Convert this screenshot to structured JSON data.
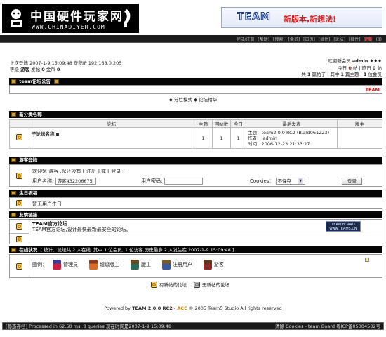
{
  "header": {
    "logo_cn": "中国硬件玩家网",
    "logo_en": "WWW.CHINADIYER.COM",
    "banner_team": "TEAM",
    "banner_slogan": "新版本,新想法!"
  },
  "navbar": {
    "links": [
      "登陆/注册",
      "[帮助]",
      "[搜索]",
      "[会员]",
      "[日历]",
      "[插件]",
      "[论坛]",
      "[插件]"
    ],
    "highlight": "更新",
    "tail": "(8)"
  },
  "user_left": {
    "line1": "上次登陆 2007-1-9 15:09:48 登陆IP 192.168.0.205",
    "line2_prefix": "等级",
    "role": "游客",
    "posts_label": "发帖",
    "posts": "0",
    "gold_label": "金币",
    "gold": "0"
  },
  "user_right": {
    "welcome": "欢迎新会员",
    "new_member": "admin",
    "stars": "♦♦♦",
    "today_label": "今日",
    "today": "0",
    "today_unit": "帖",
    "yesterday_label": "昨日",
    "yesterday": "0",
    "yesterday_unit": "帖",
    "stats": "共",
    "topics": "1",
    "stats2": "篇帖子 | 其中",
    "main": "1",
    "stats3": "篇主题 |",
    "members": "1",
    "stats4": "位会员"
  },
  "announce": {
    "title": "team论坛公告",
    "badge": "TEAM"
  },
  "modes": {
    "mode1": "分栏模式",
    "mode2": "论坛精华"
  },
  "category": {
    "title": "新分类名称",
    "headers": [
      "论坛",
      "主题",
      "回帖数",
      "今日",
      "最后发表",
      "版主"
    ],
    "forum_name": "子论坛名称",
    "topics": "1",
    "replies": "1",
    "today": "1",
    "last_topic": "主题：team2.0.0 RC2 (Build061223)",
    "last_author": "作者： admin",
    "last_time": "时间：2006-12-23 21:33:27",
    "moderator": ""
  },
  "guest": {
    "title": "游客登陆",
    "welcome": "欢迎您 游客 ,您还没有 [ 注册 ] 或 [ 登录 ]",
    "user_label": "用户名称:",
    "user_value": "游客432206675",
    "pass_label": "用户密码:",
    "pass_value": "",
    "cookies_label": "Cookies：",
    "cookies_value": "不保存",
    "login_btn": "登录"
  },
  "birthday": {
    "title": "生日祝福",
    "text": "暂无用户生日"
  },
  "links": {
    "title": "友情链接",
    "name": "TEAM官方论坛",
    "desc": "TEAM官方论坛,设计最快最新最安全的论坛。",
    "logo_line1": "TEAM BOARD",
    "logo_line2": "www.TEAM5.CN"
  },
  "online": {
    "title": "在线状况",
    "summary": "[ 统计：论坛共 2 人在线, 其中 1 位会员, 1 位访客,历史最多 2 人发生在 2007-1-9 15:09:48 ]",
    "legend_label": "图例：",
    "roles": [
      "管理员",
      "超级版主",
      "版主",
      "注册用户",
      "游客"
    ]
  },
  "legend": {
    "new_posts": "有新帖的论坛",
    "no_new_posts": "无新帖的论坛"
  },
  "footer": {
    "powered": "Powered by",
    "version": "TEAM 2.0.0 RC2",
    "dash": " - ",
    "acc": "ACC",
    "copyright": "© 2005 Team5 Studio All rights reserved",
    "status_left": "[静态存档] Processed in 62.50 ms, 8 queries 现在时间是2007-1-9 15:09:48",
    "status_right": "清除 Cookies - team Board 粤ICP备05004532号"
  },
  "colors": {
    "dark_bar": "#050505",
    "accent_red": "#d11111",
    "gold_icon": "#c8a040"
  }
}
